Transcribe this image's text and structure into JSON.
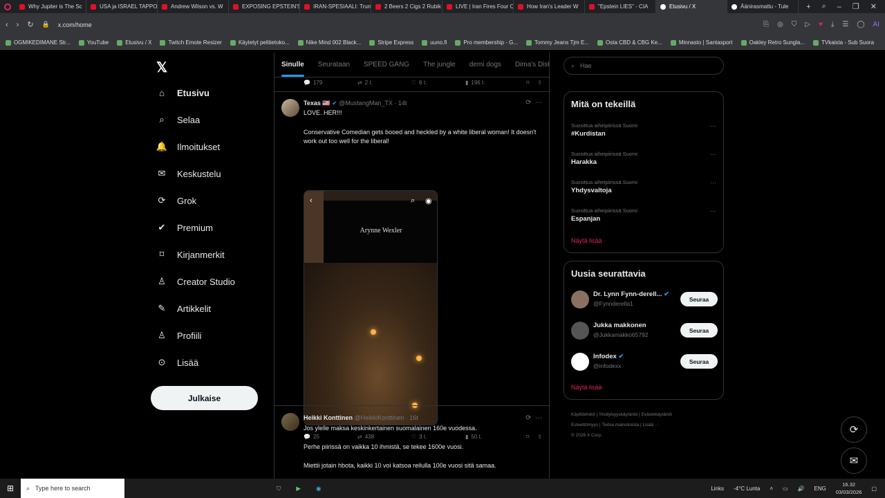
{
  "browser": {
    "tabs": [
      {
        "label": "Why Jupiter is The Sc",
        "fav": "yt"
      },
      {
        "label": "USA ja ISRAEL TAPPO",
        "fav": "yt"
      },
      {
        "label": "Andrew Wilson vs. W",
        "fav": "yt"
      },
      {
        "label": "EXPOSING EPSTEIN'S",
        "fav": "yt"
      },
      {
        "label": "IRAN-SPESIAALI: Trum",
        "fav": "yt"
      },
      {
        "label": "2 Beers 2 Cigs 2 Rubik",
        "fav": "yt"
      },
      {
        "label": "LIVE | Iran Fires Four C",
        "fav": "yt"
      },
      {
        "label": "How Iran's Leader W",
        "fav": "yt"
      },
      {
        "label": "\"Epstein LIES\" - CIA",
        "fav": "yt"
      },
      {
        "label": "Etusivu / X",
        "fav": "x",
        "active": true
      },
      {
        "label": "Äänirasmattu - Tule",
        "fav": "x"
      }
    ],
    "url": "x.com/home",
    "bookmarks": [
      "OGMIKEDIMANE Str...",
      "YouTube",
      "Etusivu / X",
      "Twitch Emote Resizer",
      "Käytetyt pelitietoko...",
      "Nike Mind 002 Black...",
      "Stripe Express",
      "uuno.fi",
      "Pro membership - G...",
      "Tommy Jeans Tjm E...",
      "Osta CBD & CBG Ke...",
      "Minnasto | Santasport",
      "Oakley Retro Sungla...",
      "TVkaista - Sub Suora"
    ]
  },
  "sidebar": {
    "items": [
      {
        "label": "Etusivu",
        "icon": "home-icon"
      },
      {
        "label": "Selaa",
        "icon": "search-icon"
      },
      {
        "label": "Ilmoitukset",
        "icon": "bell-icon"
      },
      {
        "label": "Keskustelu",
        "icon": "mail-icon"
      },
      {
        "label": "Grok",
        "icon": "grok-icon"
      },
      {
        "label": "Premium",
        "icon": "verified-icon"
      },
      {
        "label": "Kirjanmerkit",
        "icon": "bookmark-icon"
      },
      {
        "label": "Creator Studio",
        "icon": "creator-icon"
      },
      {
        "label": "Artikkelit",
        "icon": "article-icon"
      },
      {
        "label": "Profiili",
        "icon": "profile-icon"
      },
      {
        "label": "Lisää",
        "icon": "more-icon"
      }
    ],
    "post_button": "Julkaise"
  },
  "timeline": {
    "tabs": [
      "Sinulle",
      "Seurataan",
      "SPEED GANG",
      "The jungle",
      "demi dogs",
      "Dima's Dist"
    ],
    "prev_actions": {
      "replies": "179",
      "reposts": "2 t.",
      "likes": "6 t.",
      "views": "196 t."
    },
    "post1": {
      "name": "Texas",
      "flag": "🇺🇸",
      "handle": "@MustangMan_TX",
      "time": "14t",
      "line1": "LOVE. HER!!!",
      "line2": "Conservative Comedian gets booed and heckled by a white liberal woman! It doesn't work out too well for the liberal!",
      "media_text": "Arynne Wexler",
      "replies": "25",
      "reposts": "438",
      "likes": "3 t.",
      "views": "50 t."
    },
    "post2": {
      "name": "Heikki Konttinen",
      "handle": "@HeikkiKonttinen",
      "time": "16t",
      "line1": "Jos ylelle maksa keskinkertainen suomalainen 160e vuodessa.",
      "line2": "Perhe piirissä on vaikka 10 ihmistä, se tekee 1600e vuosi.",
      "line3": "Miettii jotain hbota, kaikki 10 voi katsoa reilulla 100e vuosi sitä samaa."
    }
  },
  "right": {
    "search_placeholder": "Hae",
    "trends_title": "Mitä on tekeillä",
    "trends": [
      {
        "context": "Suosittua aiheipiirissä Suomi",
        "name": "#Kurdistan"
      },
      {
        "context": "Suosittua aiheipiirissä Suomi",
        "name": "Harakka"
      },
      {
        "context": "Suosittua aiheipiirissä Suomi",
        "name": "Yhdysvaltoja"
      },
      {
        "context": "Suosittua aiheipiirissä Suomi",
        "name": "Espanjan"
      }
    ],
    "show_more": "Näytä lisää",
    "follow_title": "Uusia seurattavia",
    "follows": [
      {
        "name": "Dr. Lynn Fynn-derell...",
        "handle": "@Fynnderella1",
        "verified": true
      },
      {
        "name": "Jukka makkonen",
        "handle": "@Jukkamakko65792",
        "verified": false
      },
      {
        "name": "Infodex",
        "handle": "@infodexx",
        "verified": true
      }
    ],
    "follow_button": "Seuraa",
    "footer": [
      "Käyttöehdot",
      "Yksityisyyskäytäntö",
      "Evästekäytäntö",
      "Esteettömyys",
      "Tietoa mainoksista",
      "Lisää ···",
      "© 2026 X Corp."
    ]
  },
  "taskbar": {
    "search_placeholder": "Type here to search",
    "links": "Links",
    "weather": "-4°C  Lunta",
    "lang": "ENG",
    "time": "16.32",
    "date": "03/03/2026"
  }
}
